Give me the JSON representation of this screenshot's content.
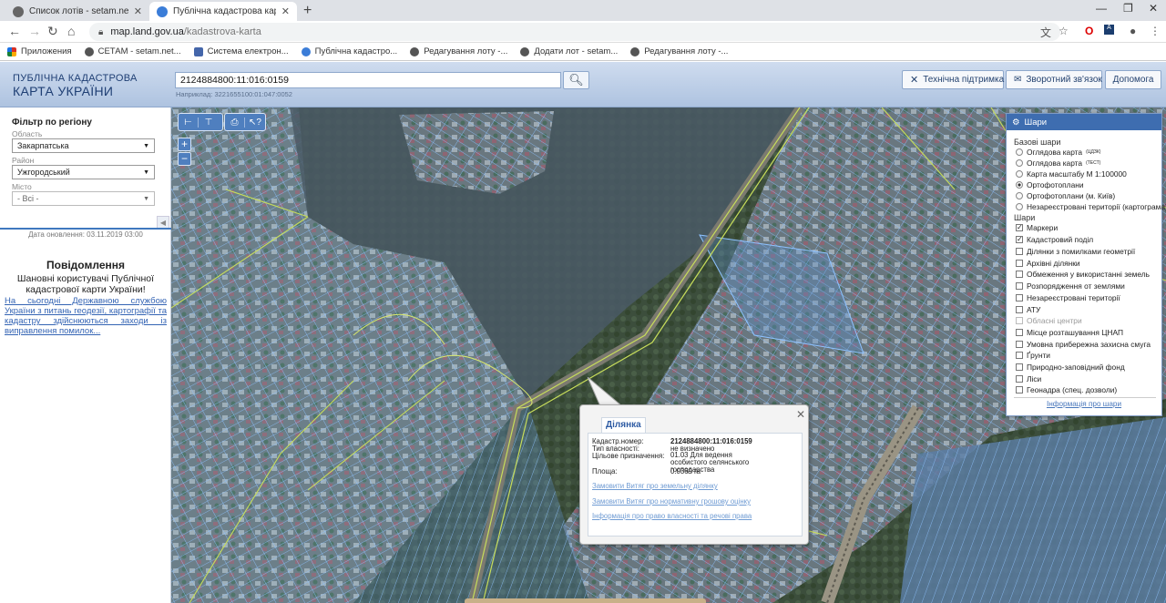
{
  "browser": {
    "tabs": [
      {
        "title": "Список лотів - setam.net.ua",
        "active": false,
        "favicon_color": "#555555"
      },
      {
        "title": "Публічна кадастрова карта Укр",
        "active": true,
        "favicon_color": "#3b7dd8"
      }
    ],
    "new_tab": "+",
    "url_domain": "map.land.gov.ua",
    "url_path": "/kadastrova-karta"
  },
  "bookmarks": [
    {
      "label": "Приложения",
      "color": "#d93025"
    },
    {
      "label": "СЕТАМ - setam.net...",
      "color": "#555555"
    },
    {
      "label": "Система електрон...",
      "color": "#4466aa"
    },
    {
      "label": "Публічна кадастро...",
      "color": "#3b7dd8"
    },
    {
      "label": "Редагування лоту -...",
      "color": "#555555"
    },
    {
      "label": "Додати лот - setam...",
      "color": "#555555"
    },
    {
      "label": "Редагування лоту -...",
      "color": "#555555"
    }
  ],
  "header": {
    "logo_line1": "ПУБЛІЧНА КАДАСТРОВА",
    "logo_line2": "КАРТА УКРАЇНИ",
    "search_value": "2124884800:11:016:0159",
    "search_hint": "Наприклад: 3221655100:01:047:0052",
    "buttons": {
      "support": "Технічна підтримка",
      "feedback": "Зворотний зв'язок",
      "help": "Допомога"
    }
  },
  "filter": {
    "title": "Фільтр по регіону",
    "region_label": "Область",
    "region_value": "Закарпатська",
    "district_label": "Район",
    "district_value": "Ужгородський",
    "city_label": "Місто",
    "city_value": "- Всі -"
  },
  "updated": "Дата оновлення: 03.11.2019 03:00",
  "notice": {
    "title": "Повідомлення",
    "greeting": "Шановні користувачі Публічної кадастрової карти України!",
    "link": "На сьогодні Державною службою України з питань геодезії, картографії та кадастру здійснюються заходи із виправлення помилок..."
  },
  "map_tools": {
    "group1": [
      "⊢",
      "⊤"
    ],
    "group2": [
      "⎙",
      "↖?"
    ],
    "zoom_in": "+",
    "zoom_out": "−"
  },
  "layers": {
    "title": "Шари",
    "base_title": "Базові шари",
    "base": [
      {
        "label": "Оглядова карта",
        "sup": "(ЦДЗК)",
        "selected": false
      },
      {
        "label": "Оглядова карта",
        "sup": "(ТЕСТ)",
        "selected": false
      },
      {
        "label": "Карта масштабу М 1:100000",
        "sup": "",
        "selected": false
      },
      {
        "label": "Ортофотоплани",
        "sup": "",
        "selected": true
      },
      {
        "label": "Ортофотоплани (м. Київ)",
        "sup": "",
        "selected": false
      },
      {
        "label": "Незареєстровані території (картограма)",
        "sup": "",
        "selected": false
      }
    ],
    "overlay_title": "Шари",
    "overlays": [
      {
        "label": "Маркери",
        "checked": true,
        "disabled": false
      },
      {
        "label": "Кадастровий поділ",
        "checked": true,
        "disabled": false
      },
      {
        "label": "Ділянки з помилками геометрії",
        "checked": false,
        "disabled": false
      },
      {
        "label": "Архівні ділянки",
        "checked": false,
        "disabled": false
      },
      {
        "label": "Обмеження у використанні земель",
        "checked": false,
        "disabled": false
      },
      {
        "label": "Розпорядження от землями",
        "checked": false,
        "disabled": false
      },
      {
        "label": "Незареєстровані території",
        "checked": false,
        "disabled": false
      },
      {
        "label": "АТУ",
        "checked": false,
        "disabled": false
      },
      {
        "label": "Обласні центри",
        "checked": false,
        "disabled": true
      },
      {
        "label": "Місце розташування ЦНАП",
        "checked": false,
        "disabled": false
      },
      {
        "label": "Умовна прибережна захисна смуга",
        "checked": false,
        "disabled": false
      },
      {
        "label": "Ґрунти",
        "checked": false,
        "disabled": false
      },
      {
        "label": "Природно-заповідний фонд",
        "checked": false,
        "disabled": false
      },
      {
        "label": "Ліси",
        "checked": false,
        "disabled": false
      },
      {
        "label": "Геонадра (спец. дозволи)",
        "checked": false,
        "disabled": false
      }
    ],
    "footer_link": "Інформація про шари"
  },
  "popup": {
    "tab": "Ділянка",
    "cad_label": "Кадастр.номер:",
    "cad_value": "2124884800:11:016:0159",
    "own_label": "Тип власності:",
    "own_value": "не визначено",
    "purpose_label": "Цільове призначення:",
    "purpose_value": "01.03 Для ведення особистого селянського господарства",
    "area_label": "Площа:",
    "area_value": "0.0369 га",
    "links": [
      "Замовити Витяг про земельну ділянку",
      "Замовити Витяг про нормативну грошову оцінку",
      "Інформація про право власності та речові права"
    ]
  }
}
